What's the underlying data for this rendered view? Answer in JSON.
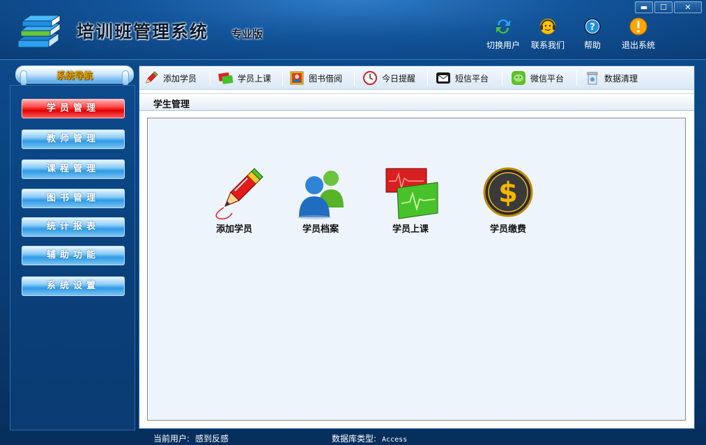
{
  "window": {
    "title": "培训班管理系统",
    "edition": "专业版",
    "controls": {
      "minimize": "▬",
      "maximize": "☐",
      "close": "✕"
    }
  },
  "header_actions": [
    {
      "label": "切换用户",
      "icon": "switch-user-icon"
    },
    {
      "label": "联系我们",
      "icon": "contact-icon"
    },
    {
      "label": "帮助",
      "icon": "help-icon"
    },
    {
      "label": "退出系统",
      "icon": "exit-icon"
    }
  ],
  "sidebar": {
    "title": "系统导航",
    "items": [
      {
        "label": "学员管理",
        "active": true
      },
      {
        "label": "教师管理",
        "active": false
      },
      {
        "label": "课程管理",
        "active": false
      },
      {
        "label": "图书管理",
        "active": false
      },
      {
        "label": "统计报表",
        "active": false
      },
      {
        "label": "辅助功能",
        "active": false
      },
      {
        "label": "系统设置",
        "active": false
      }
    ]
  },
  "toolbar": [
    {
      "label": "添加学员",
      "icon": "pen-icon"
    },
    {
      "label": "学员上课",
      "icon": "card-icon"
    },
    {
      "label": "图书借阅",
      "icon": "book-icon"
    },
    {
      "label": "今日提醒",
      "icon": "clock-icon"
    },
    {
      "label": "短信平台",
      "icon": "envelope-icon"
    },
    {
      "label": "微信平台",
      "icon": "wechat-icon"
    },
    {
      "label": "数据清理",
      "icon": "trash-icon"
    }
  ],
  "main": {
    "section_title": "学生管理",
    "functions": [
      {
        "label": "添加学员",
        "icon": "pen-icon"
      },
      {
        "label": "学员档案",
        "icon": "users-icon"
      },
      {
        "label": "学员上课",
        "icon": "cards-icon"
      },
      {
        "label": "学员缴费",
        "icon": "dollar-icon"
      }
    ]
  },
  "status": {
    "user_label": "当前用户:",
    "user_value": "感到反感",
    "db_label": "数据库类型:",
    "db_value": "Access"
  },
  "colors": {
    "accent_active": "#e00000",
    "nav_button": "#2e9ae6",
    "header": "#12549a"
  }
}
